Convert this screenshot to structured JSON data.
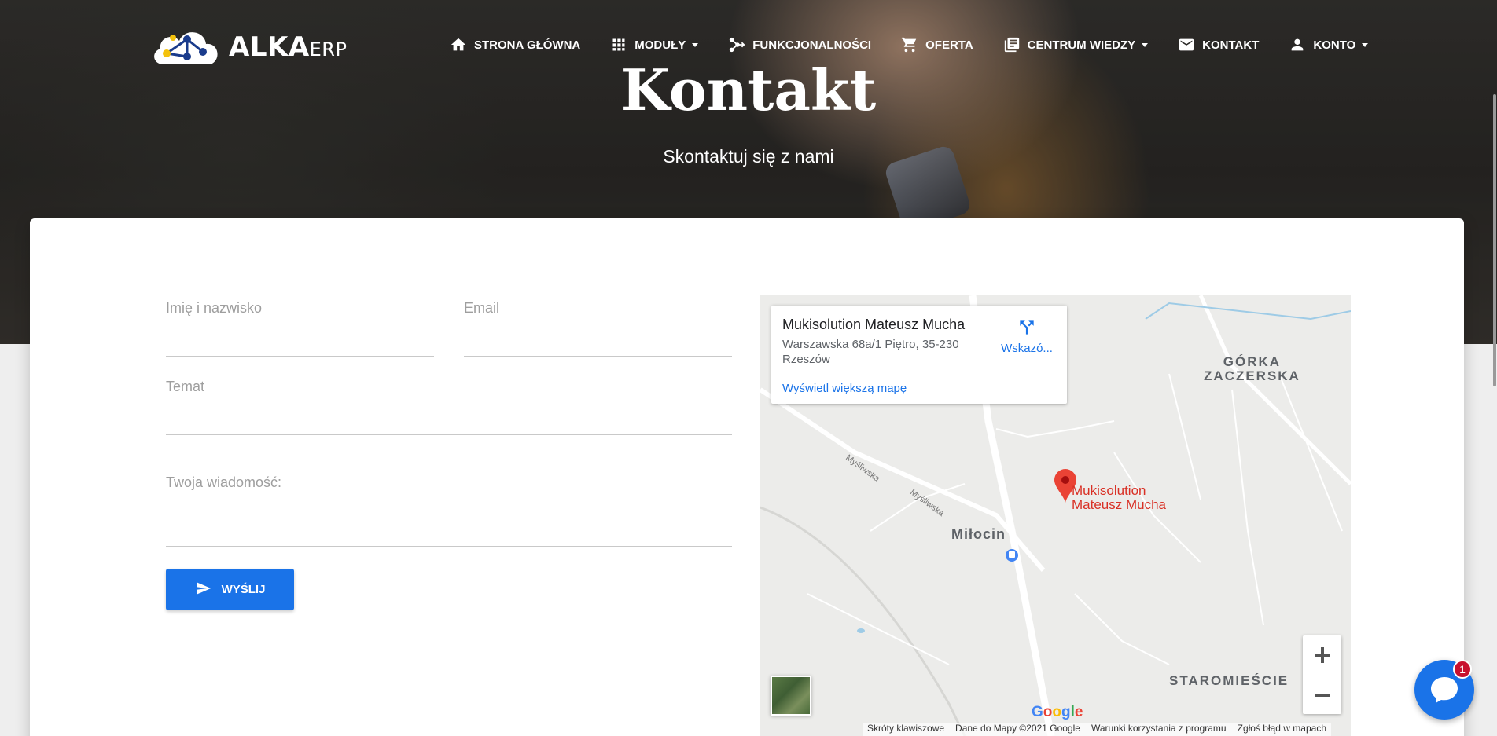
{
  "brand": {
    "logo_main": "ALKA",
    "logo_sub": "ERP",
    "colors": {
      "primary": "#1a73e8",
      "hero_text": "#ffffff",
      "label_gray": "#9e9e9e",
      "badge": "#c8102e"
    }
  },
  "nav": {
    "items": [
      {
        "label": "STRONA GŁÓWNA",
        "icon": "home-icon"
      },
      {
        "label": "MODUŁY",
        "icon": "grid-icon",
        "dropdown": true
      },
      {
        "label": "FUNKCJONALNOŚCI",
        "icon": "flow-icon"
      },
      {
        "label": "OFERTA",
        "icon": "cart-icon"
      },
      {
        "label": "CENTRUM WIEDZY",
        "icon": "library-icon",
        "dropdown": true
      },
      {
        "label": "KONTAKT",
        "icon": "mail-icon"
      },
      {
        "label": "KONTO",
        "icon": "person-icon",
        "dropdown": true
      }
    ]
  },
  "hero": {
    "title": "Kontakt",
    "subtitle": "Skontaktuj się z nami"
  },
  "form": {
    "name_label": "Imię i nazwisko",
    "email_label": "Email",
    "subject_label": "Temat",
    "message_label": "Twoja wiadomość:",
    "send_label": "WYŚLIJ"
  },
  "map": {
    "place_name": "Mukisolution Mateusz Mucha",
    "address": "Warszawska 68a/1 Piętro, 35-230 Rzeszów",
    "directions_label": "Wskazó...",
    "bigger_map_label": "Wyświetl większą mapę",
    "pin_label_line1": "Mukisolution",
    "pin_label_line2": "Mateusz Mucha",
    "places": {
      "gorka_line1": "GÓRKA",
      "gorka_line2": "ZACZERSKA",
      "milocin": "Miłocin",
      "staromiescie": "STAROMIEŚCIE"
    },
    "streets": {
      "mysliwska1": "Myśliwska",
      "mysliwska2": "Myśliwska"
    },
    "google": "Google",
    "footer": [
      "Skróty klawiszowe",
      "Dane do Mapy ©2021 Google",
      "Warunki korzystania z programu",
      "Zgłoś błąd w mapach"
    ]
  },
  "chat": {
    "badge_count": "1"
  }
}
